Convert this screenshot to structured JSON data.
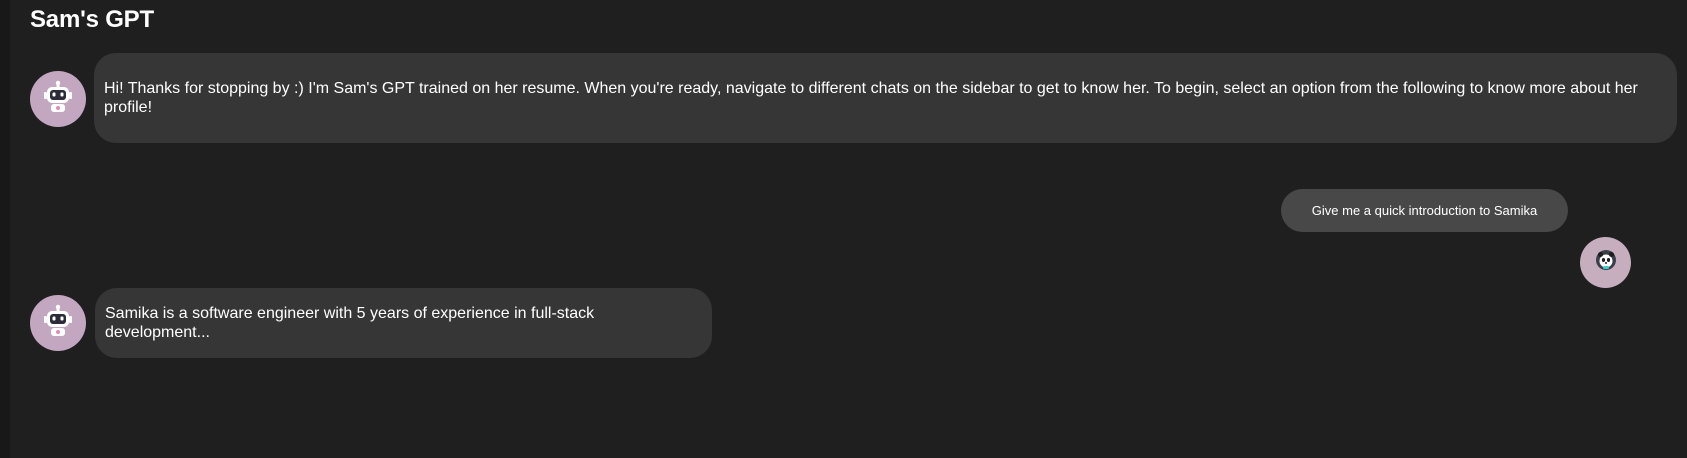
{
  "app": {
    "title": "Sam's GPT"
  },
  "colors": {
    "background": "#1f1f1f",
    "bot_bubble": "#363636",
    "user_bubble": "#484848",
    "avatar": "#c3a6bf"
  },
  "messages": [
    {
      "role": "bot",
      "avatar_icon": "robot-icon",
      "text": "Hi! Thanks for stopping by :) I'm Sam's GPT trained on her resume. When you're ready, navigate to different chats on the sidebar to get to know her. To begin, select an option from the following to know more about her profile!"
    },
    {
      "role": "user",
      "avatar_icon": "panda-icon",
      "text": "Give me a quick introduction to Samika"
    },
    {
      "role": "bot",
      "avatar_icon": "robot-icon",
      "text": "Samika is a software engineer with 5 years of experience in full-stack development..."
    }
  ]
}
